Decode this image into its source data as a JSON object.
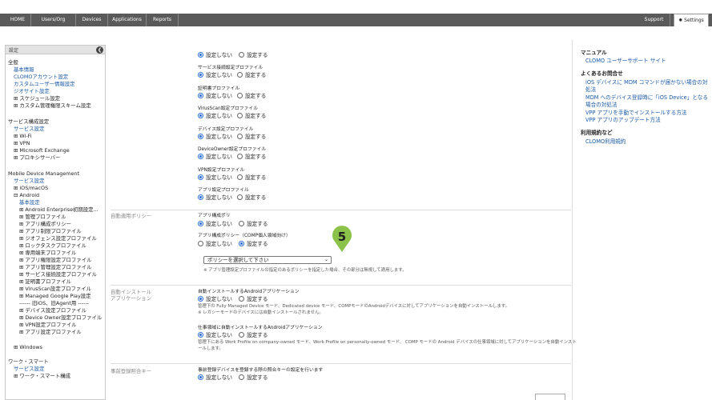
{
  "nav": {
    "home": "HOME",
    "users_org": "Users/Org",
    "devices": "Devices",
    "applications": "Applications",
    "reports": "Reports",
    "support": "Support",
    "settings": "Settings"
  },
  "sidebar": {
    "header": "設定",
    "lines": [
      {
        "text": "全般",
        "style": "plain"
      },
      {
        "text": "基本情報",
        "style": "link"
      },
      {
        "text": "CLOMOアカウント設定",
        "style": "link"
      },
      {
        "text": "カスタムユーザー情報設定",
        "style": "link"
      },
      {
        "text": "ジオサイト設定",
        "style": "link"
      },
      {
        "text": "⊞ スケジュール設定",
        "style": "plain"
      },
      {
        "text": "⊞ カスタム管理権限スキーム設定",
        "style": "plain"
      },
      {
        "text": "サービス構成設定",
        "style": "plain"
      },
      {
        "text": "サービス設定",
        "style": "link"
      },
      {
        "text": "⊞ Wi-Fi",
        "style": "plain"
      },
      {
        "text": "⊞ VPN",
        "style": "plain"
      },
      {
        "text": "⊞ Microsoft Exchange",
        "style": "plain"
      },
      {
        "text": "⊞ プロキシサーバー",
        "style": "plain"
      },
      {
        "text": "Mobile Device Management",
        "style": "plain"
      },
      {
        "text": "サービス設定",
        "style": "link"
      },
      {
        "text": "⊞ iOS/macOS",
        "style": "plain"
      },
      {
        "text": "⊟ Android",
        "style": "plain"
      },
      {
        "text": "基本設定",
        "style": "link"
      },
      {
        "text": "⊞ Android Enterprise初期設定...",
        "style": "plain"
      },
      {
        "text": "⊞ 管理プロファイル",
        "style": "plain"
      },
      {
        "text": "⊞ アプリ構成ポリシー",
        "style": "plain"
      },
      {
        "text": "⊞ アプリ制限プロファイル",
        "style": "plain"
      },
      {
        "text": "⊞ ジオフェンス設定プロファイル",
        "style": "plain"
      },
      {
        "text": "⊞ ロックタスクプロファイル",
        "style": "plain"
      },
      {
        "text": "⊞ 専用端末プロファイル",
        "style": "plain"
      },
      {
        "text": "⊞ アプリ権限設定プロファイル",
        "style": "plain"
      },
      {
        "text": "⊞ アプリ管理設定プロファイル",
        "style": "plain"
      },
      {
        "text": "⊞ サービス接続設定プロファイル",
        "style": "plain"
      },
      {
        "text": "⊞ 証明書プロファイル",
        "style": "plain"
      },
      {
        "text": "⊞ VirusScan設定プロファイル",
        "style": "plain"
      },
      {
        "text": "⊞ Managed Google Play設定",
        "style": "plain"
      },
      {
        "text": "------ 旧iOS、旧Agent用 ------",
        "style": "plain"
      },
      {
        "text": "⊞ デバイス設定プロファイル",
        "style": "plain"
      },
      {
        "text": "⊞ Device Owner設定プロファイル",
        "style": "plain"
      },
      {
        "text": "⊞ VPN設定プロファイル",
        "style": "plain"
      },
      {
        "text": "⊞ アプリ設定プロファイル",
        "style": "plain"
      },
      {
        "text": "⊞ Windows",
        "style": "plain"
      },
      {
        "text": "ワーク・スマート",
        "style": "plain"
      },
      {
        "text": "サービス設定",
        "style": "link"
      },
      {
        "text": "⊞ ワーク・スマート構成",
        "style": "plain"
      }
    ]
  },
  "right": {
    "manual_heading": "マニュアル",
    "manual_link": "CLOMO ユーザーサポート サイト",
    "faq_heading": "よくあるお問合せ",
    "faq_links": [
      "iOS デバイスに MDM コマンドが届かない場合の対",
      "処法",
      "MDM へのデバイス登録時に「iOS Device」となる",
      "場合の対処法",
      "VPP アプリを手動でインストールする方法",
      "VPP アプリのアップデート方法"
    ],
    "terms_heading": "利用規約など",
    "terms_link": "CLOMO利用規約"
  },
  "main": {
    "opt_off": "設定しない",
    "opt_on": "設定する",
    "profiles": [
      "サービス接続設定プロファイル",
      "証明書プロファイル",
      "VirusScan設定プロファイル",
      "デバイス設定プロファイル",
      "DeviceOwner設定プロファイル",
      "VPN設定プロファイル",
      "アプリ設定プロファイル"
    ],
    "auto_policy_label": "自動適用ポリシー",
    "app_policy_title": "アプリ構成ポリ",
    "app_policy_comp_title": "アプリ構成ポリシー（COMP個人領域向け）",
    "select_value": "ポリシーを選択して下さい",
    "select_note": "※ アプリ管理設定プロファイルの指定のあるポリシーを指定した場合、その部分は無視して適用します。",
    "auto_install_label_1": "自動インストール",
    "auto_install_label_2": "アプリケーション",
    "auto_install_title": "自動インストールするAndroidアプリケーション",
    "auto_install_desc": "管理下の Fully Managed Device モード、Dedicated device モード、COMPモードのAndroidデバイスに対してアプリケーションを自動インストールします。",
    "auto_install_note": "※ レガシーモードのデバイスには自動インストールされません。",
    "work_install_title": "仕事領域に自動インストールするAndroidアプリケーション",
    "work_install_desc_1": "管理下にある Work Profile on company-owned モード、Work Profile on personally-owned モード、 COMP モードの Android デバイスの仕事領域に対してアプリケーションを自動インスト",
    "work_install_desc_2": "ールします。",
    "prereg_label": "事前登録照合キー",
    "prereg_title": "事前登録デバイスを登録する際の照合キーの設定を行います",
    "marker_number": "5"
  }
}
